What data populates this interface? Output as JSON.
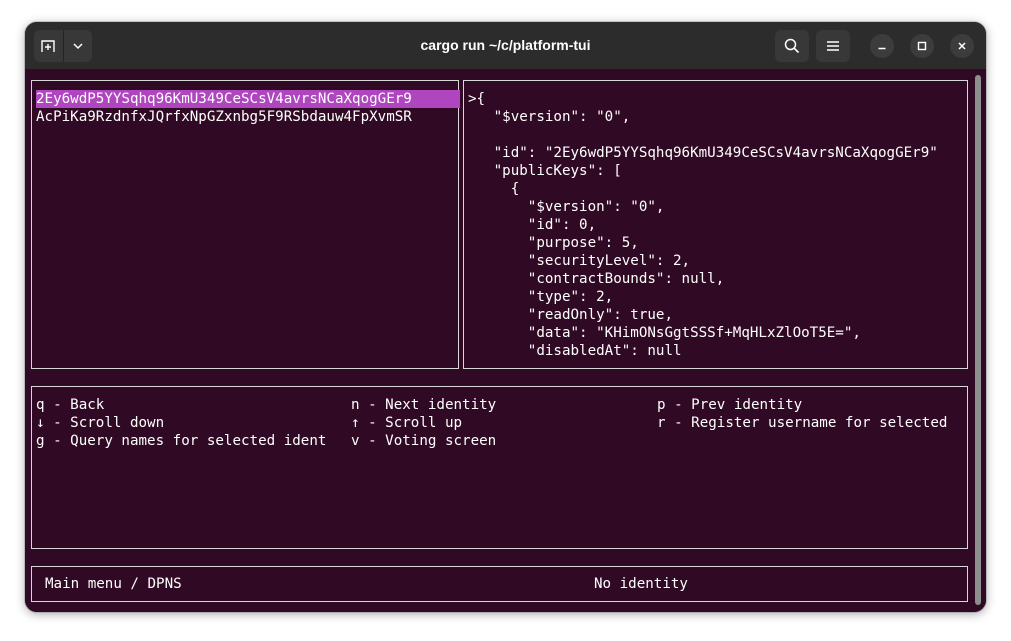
{
  "window": {
    "title": "cargo run ~/c/platform-tui"
  },
  "identities": {
    "items": [
      {
        "id": "2Ey6wdP5YYSqhq96KmU349CeSCsV4avrsNCaXqogGEr9",
        "selected": true
      },
      {
        "id": "AcPiKa9RzdnfxJQrfxNpGZxnbg5F9RSbdauw4FpXvmSR",
        "selected": false
      }
    ]
  },
  "details": {
    "lines": [
      ">{",
      "   \"$version\": \"0\",",
      "",
      "   \"id\": \"2Ey6wdP5YYSqhq96KmU349CeSCsV4avrsNCaXqogGEr9\"",
      "   \"publicKeys\": [",
      "     {",
      "       \"$version\": \"0\",",
      "       \"id\": 0,",
      "       \"purpose\": 5,",
      "       \"securityLevel\": 2,",
      "       \"contractBounds\": null,",
      "       \"type\": 2,",
      "       \"readOnly\": true,",
      "       \"data\": \"KHimONsGgtSSSf+MqHLxZlOoT5E=\",",
      "       \"disabledAt\": null"
    ]
  },
  "keybindings": {
    "col1": [
      "q - Back",
      "↓ - Scroll down",
      "g - Query names for selected ident"
    ],
    "col2": [
      "n - Next identity",
      "↑ - Scroll up",
      "v - Voting screen"
    ],
    "col3": [
      "p - Prev identity",
      "r - Register username for selected"
    ]
  },
  "status": {
    "breadcrumb": "Main menu / DPNS",
    "identity": "No identity"
  }
}
